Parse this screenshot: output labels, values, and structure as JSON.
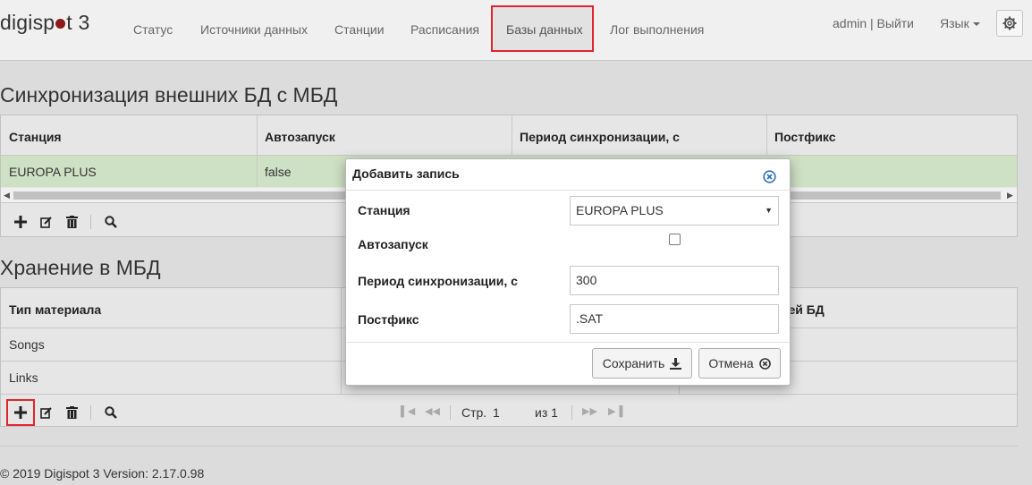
{
  "app": {
    "brand_prefix": "digisp",
    "brand_suffix": "t 3"
  },
  "nav": {
    "items": [
      {
        "label": "Статус"
      },
      {
        "label": "Источники данных"
      },
      {
        "label": "Станции"
      },
      {
        "label": "Расписания"
      },
      {
        "label": "Базы данных"
      },
      {
        "label": "Лог выполнения"
      }
    ],
    "user": "admin | Выйти",
    "language": "Язык"
  },
  "sync": {
    "title": "Синхронизация внешних БД с МБД",
    "columns": [
      "Станция",
      "Автозапуск",
      "Период синхронизации, с",
      "Постфикс"
    ],
    "rows": [
      {
        "station": "EUROPA PLUS",
        "autostart": "false"
      }
    ]
  },
  "storage": {
    "title": "Хранение в МБД",
    "columns": [
      "Тип материала",
      "ней БД"
    ],
    "rows": [
      {
        "type": "Songs"
      },
      {
        "type": "Links"
      }
    ],
    "pager": {
      "page_label": "Стр.",
      "page_value": "1",
      "of_label": "из 1"
    }
  },
  "modal": {
    "title": "Добавить запись",
    "fields": {
      "station_label": "Станция",
      "station_value": "EUROPA PLUS",
      "autostart_label": "Автозапуск",
      "period_label": "Период синхронизации, с",
      "period_value": "300",
      "postfix_label": "Постфикс",
      "postfix_value": ".SAT"
    },
    "save_label": "Сохранить",
    "cancel_label": "Отмена"
  },
  "footer": {
    "text": "© 2019 Digispot 3 Version: 2.17.0.98"
  },
  "colors": {
    "highlight": "#e0252d",
    "selected_row": "#cfe1c4",
    "brand_dot": "#8b1a1a"
  }
}
